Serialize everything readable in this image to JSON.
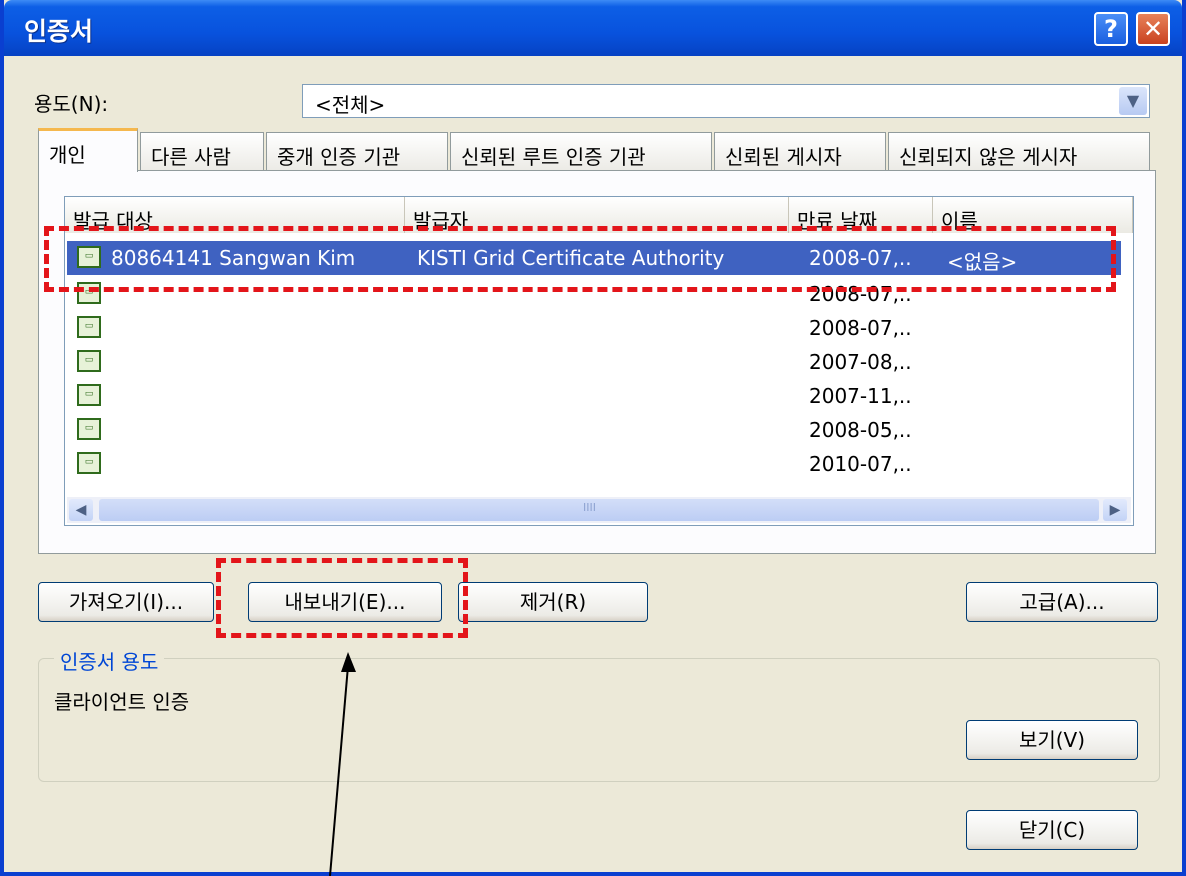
{
  "window": {
    "title": "인증서",
    "help_label": "?",
    "close_label": "✕"
  },
  "purpose": {
    "label": "용도(N):",
    "value": "<전체>"
  },
  "tabs": [
    "개인",
    "다른 사람",
    "중개 인증 기관",
    "신뢰된 루트 인증 기관",
    "신뢰된 게시자",
    "신뢰되지 않은 게시자"
  ],
  "columns": [
    "발급 대상",
    "발급자",
    "만료 날짜",
    "이름"
  ],
  "rows": [
    {
      "issued_to": "80864141 Sangwan Kim",
      "issued_by": "KISTI Grid Certificate Authority",
      "expires": "2008-07,..",
      "name": "<없음>",
      "selected": true
    },
    {
      "issued_to": "",
      "issued_by": "",
      "expires": "2008-07,..",
      "name": ""
    },
    {
      "issued_to": "",
      "issued_by": "",
      "expires": "2008-07,..",
      "name": ""
    },
    {
      "issued_to": "",
      "issued_by": "",
      "expires": "2007-08,..",
      "name": ""
    },
    {
      "issued_to": "",
      "issued_by": "",
      "expires": "2007-11,..",
      "name": ""
    },
    {
      "issued_to": "",
      "issued_by": "",
      "expires": "2008-05,..",
      "name": ""
    },
    {
      "issued_to": "",
      "issued_by": "",
      "expires": "2010-07,..",
      "name": ""
    }
  ],
  "buttons": {
    "import": "가져오기(I)...",
    "export": "내보내기(E)...",
    "remove": "제거(R)",
    "advanced": "고급(A)...",
    "view": "보기(V)",
    "close": "닫기(C)"
  },
  "cert_purpose": {
    "title": "인증서 용도",
    "value": "클라이언트 인증"
  },
  "icons": {
    "cert": "certificate-icon",
    "scroll_left": "◀",
    "scroll_right": "▶",
    "scroll_grip": "IIII"
  },
  "colors": {
    "titlebar": "#0852dd",
    "selection": "#3f62c1",
    "highlight": "#e3151a"
  }
}
